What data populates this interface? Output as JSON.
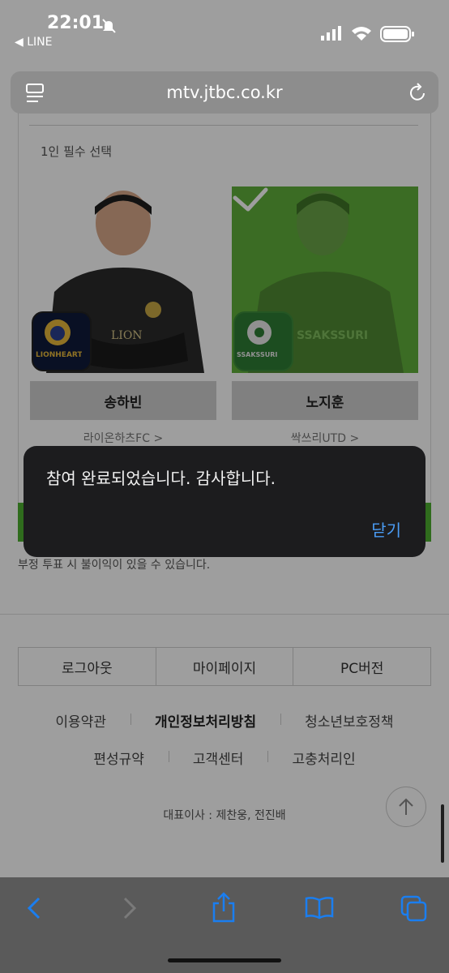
{
  "status_bar": {
    "time": "22:01",
    "back_app": "◀ LINE"
  },
  "browser": {
    "url": "mtv.jtbc.co.kr"
  },
  "vote": {
    "pick_label": "1인 필수 선택",
    "players": [
      {
        "name": "송하빈",
        "team": "라이온하츠FC >",
        "team_logo": "LIONHEARTS",
        "jersey_text": "LION",
        "selected": false
      },
      {
        "name": "노지훈",
        "team": "싹쓰리UTD >",
        "team_logo": "SSAKSSURI",
        "jersey_text": "SSAKSSURI",
        "selected": true
      }
    ],
    "notice": "부정 투표 시 불이익이 있을 수 있습니다."
  },
  "alert": {
    "message": "참여 완료되었습니다. 감사합니다.",
    "close_label": "닫기"
  },
  "footer": {
    "tabs": [
      "로그아웃",
      "마이페이지",
      "PC버전"
    ],
    "links_row1": [
      "이용약관",
      "개인정보처리방침",
      "청소년보호정책"
    ],
    "links_row2": [
      "편성규약",
      "고객센터",
      "고충처리인"
    ],
    "ceo": "대표이사 : 제찬웅, 전진배"
  },
  "colors": {
    "selected_green": "#5fae3a",
    "alert_bg": "#1c1c1e",
    "link_blue": "#4a9cf5"
  },
  "icons": [
    "reader-icon",
    "reload-icon",
    "back-icon",
    "forward-icon",
    "share-icon",
    "bookmarks-icon",
    "tabs-icon",
    "scroll-top-icon",
    "check-icon"
  ]
}
